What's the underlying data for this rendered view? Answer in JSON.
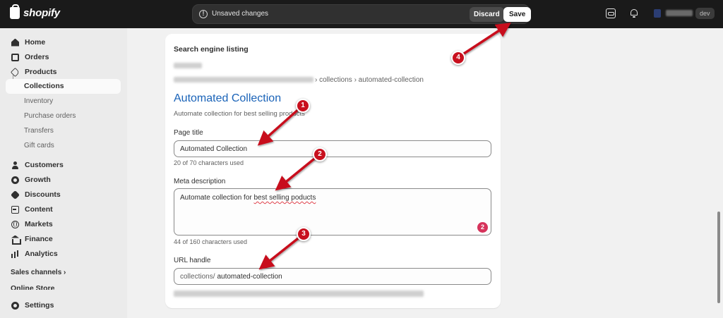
{
  "topbar": {
    "logo_text": "shopify",
    "unsaved_message": "Unsaved changes",
    "discard_label": "Discard",
    "save_label": "Save",
    "badge_text": "dev"
  },
  "sidebar": {
    "items": [
      {
        "label": "Home",
        "icon": "home-icon"
      },
      {
        "label": "Orders",
        "icon": "orders-icon"
      },
      {
        "label": "Products",
        "icon": "tag-icon"
      },
      {
        "label": "Collections"
      },
      {
        "label": "Inventory"
      },
      {
        "label": "Purchase orders"
      },
      {
        "label": "Transfers"
      },
      {
        "label": "Gift cards"
      },
      {
        "label": "Customers",
        "icon": "person-icon"
      },
      {
        "label": "Growth",
        "icon": "growth-icon"
      },
      {
        "label": "Discounts",
        "icon": "discount-icon"
      },
      {
        "label": "Content",
        "icon": "content-icon"
      },
      {
        "label": "Markets",
        "icon": "globe-icon"
      },
      {
        "label": "Finance",
        "icon": "bank-icon"
      },
      {
        "label": "Analytics",
        "icon": "chart-icon"
      }
    ],
    "sales_channels": "Sales channels ›",
    "online_store": "Online Store",
    "settings": "Settings"
  },
  "seo": {
    "section_title": "Search engine listing",
    "breadcrumb": "› collections › automated-collection",
    "preview_title": "Automated Collection",
    "preview_description": "Automate collection for best selling products",
    "page_title_label": "Page title",
    "page_title_value": "Automated Collection",
    "page_title_helper": "20 of 70 characters used",
    "meta_label": "Meta description",
    "meta_prefix": "Automate collection for ",
    "meta_misspelled": "best selling poducts",
    "meta_helper": "44 of 160 characters used",
    "meta_badge": "2",
    "url_label": "URL handle",
    "url_prefix": "collections/",
    "url_value": "automated-collection"
  },
  "annotations": {
    "markers": [
      "1",
      "2",
      "3",
      "4"
    ],
    "color": "#c8101e"
  }
}
